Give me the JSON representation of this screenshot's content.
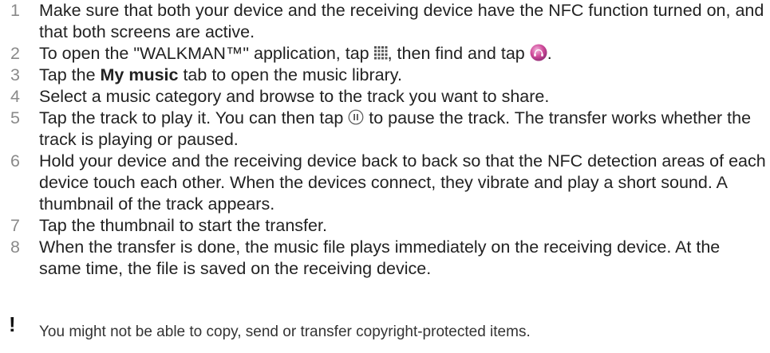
{
  "steps": [
    {
      "num": "1",
      "text": "Make sure that both your device and the receiving device have the NFC function turned on, and that both screens are active."
    },
    {
      "num": "2",
      "text_before": "To open the \"WALKMAN™\" application, tap ",
      "text_middle": ", then find and tap ",
      "text_after": ".",
      "icons": [
        "apps-grid-icon",
        "walkman-app-icon"
      ]
    },
    {
      "num": "3",
      "text_before": "Tap the ",
      "bold": "My music",
      "text_after": " tab to open the music library."
    },
    {
      "num": "4",
      "text": "Select a music category and browse to the track you want to share."
    },
    {
      "num": "5",
      "text_before": "Tap the track to play it. You can then tap ",
      "text_after": " to pause the track. The transfer works whether the track is playing or paused.",
      "icons": [
        "pause-icon"
      ]
    },
    {
      "num": "6",
      "text": "Hold your device and the receiving device back to back so that the NFC detection areas of each device touch each other. When the devices connect, they vibrate and play a short sound. A thumbnail of the track appears."
    },
    {
      "num": "7",
      "text": "Tap the thumbnail to start the transfer."
    },
    {
      "num": "8",
      "text": "When the transfer is done, the music file plays immediately on the receiving device. At the same time, the file is saved on the receiving device."
    }
  ],
  "note": {
    "mark": "!",
    "text": "You might not be able to copy, send or transfer copyright-protected items."
  },
  "colors": {
    "step_number": "#8a8a8a",
    "body_text": "#222222",
    "walkman_icon": "#d04a9a"
  }
}
